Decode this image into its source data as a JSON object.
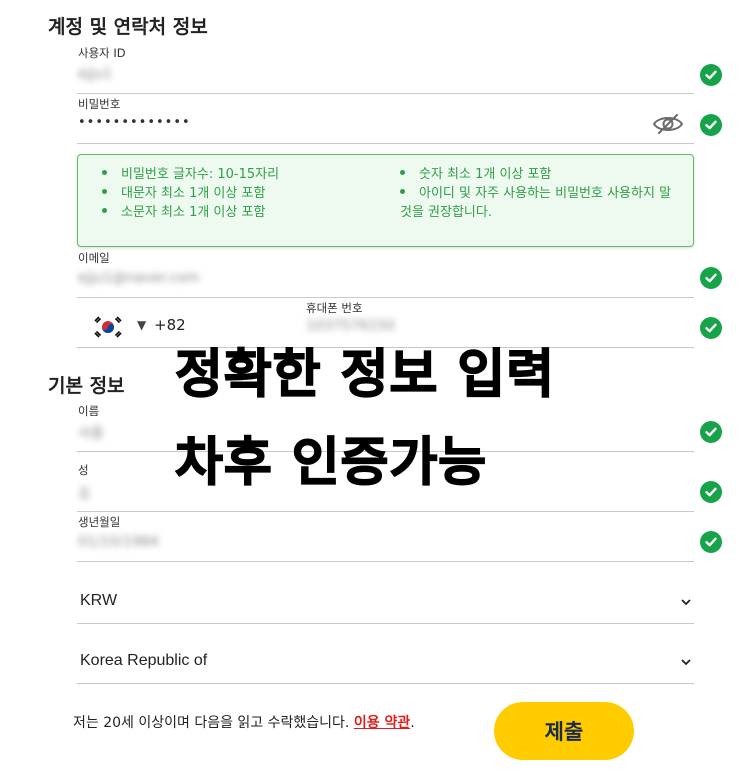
{
  "sections": {
    "account": "계정 및 연락처 정보",
    "basic": "기본 정보"
  },
  "fields": {
    "username": {
      "label": "사용자 ID",
      "value": "ejju1"
    },
    "password": {
      "label": "비밀번호",
      "value": "•••••••••••••"
    },
    "email": {
      "label": "이메일",
      "value": "ejju1@naver.com"
    },
    "phone": {
      "label": "휴대폰 번호",
      "country_code": "+82",
      "value": "1037576150"
    },
    "first_name": {
      "label": "이름",
      "value": "서중"
    },
    "last_name": {
      "label": "성",
      "value": "조"
    },
    "birthdate": {
      "label": "생년월일",
      "value": "01/10/1984"
    }
  },
  "password_rules": {
    "left": [
      "비밀번호 글자수: 10-15자리",
      "대문자 최소 1개 이상 포함",
      "소문자 최소 1개 이상 포함"
    ],
    "right": [
      "숫자 최소 1개 이상 포함",
      "아이디 및 자주 사용하는 비밀번호 사용하지 말 것을 권장합니다."
    ]
  },
  "overlay_text": {
    "line1": "정확한 정보 입력",
    "line2": "차후 인증가능"
  },
  "selects": {
    "currency": "KRW",
    "country": "Korea Republic of"
  },
  "terms": {
    "text": "저는 20세 이상이며 다음을 읽고 수락했습니다.",
    "link": "이용 약관",
    "suffix": "."
  },
  "submit_label": "제출",
  "colors": {
    "check": "#17a34a",
    "rule_text": "#2f9e47",
    "submit_bg": "#ffcc00",
    "terms_link": "#e01e1e"
  },
  "icons": {
    "valid": "check-circle-icon",
    "toggle_password": "eye-slash-icon",
    "dropdown": "chevron-down-icon",
    "flag": "south-korea-flag-icon"
  }
}
